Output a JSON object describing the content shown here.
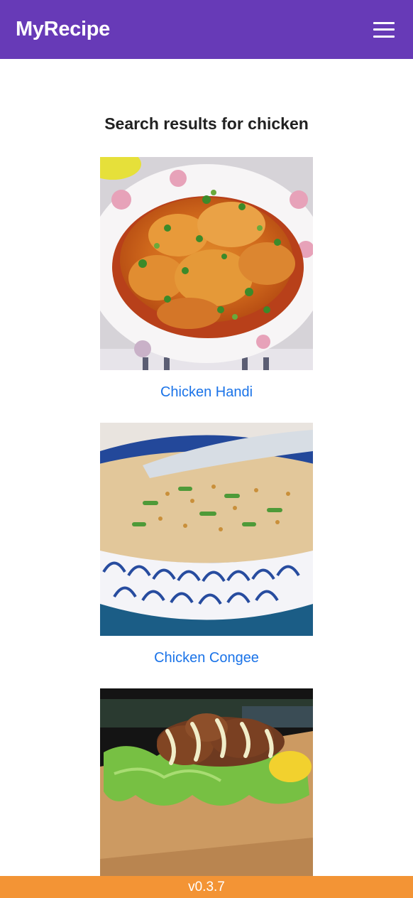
{
  "header": {
    "brand": "MyRecipe",
    "menu_icon": "hamburger-menu-icon"
  },
  "search": {
    "heading": "Search results for chicken"
  },
  "results": [
    {
      "title": "Chicken Handi",
      "image": "chicken-handi-photo"
    },
    {
      "title": "Chicken Congee",
      "image": "chicken-congee-photo"
    },
    {
      "title": "",
      "image": "fried-chicken-lettuce-photo"
    }
  ],
  "footer": {
    "version": "v0.3.7"
  },
  "colors": {
    "header_bg": "#673ab7",
    "link": "#1a73e8",
    "footer_bg": "#f39435"
  }
}
